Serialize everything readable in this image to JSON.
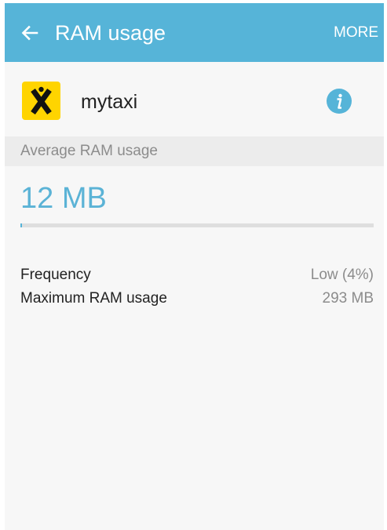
{
  "appbar": {
    "back_icon": "arrow-left-icon",
    "title": "RAM usage",
    "more_label": "MORE",
    "color": "#56b4d8"
  },
  "app": {
    "name": "mytaxi",
    "icon": "mytaxi-logo-icon",
    "icon_bg": "#ffd400",
    "info_icon": "info-icon"
  },
  "average": {
    "header": "Average RAM usage",
    "value": "12 MB",
    "bar_fraction": 0.004
  },
  "stats": [
    {
      "label": "Frequency",
      "value": "Low (4%)"
    },
    {
      "label": "Maximum RAM usage",
      "value": "293 MB"
    }
  ]
}
